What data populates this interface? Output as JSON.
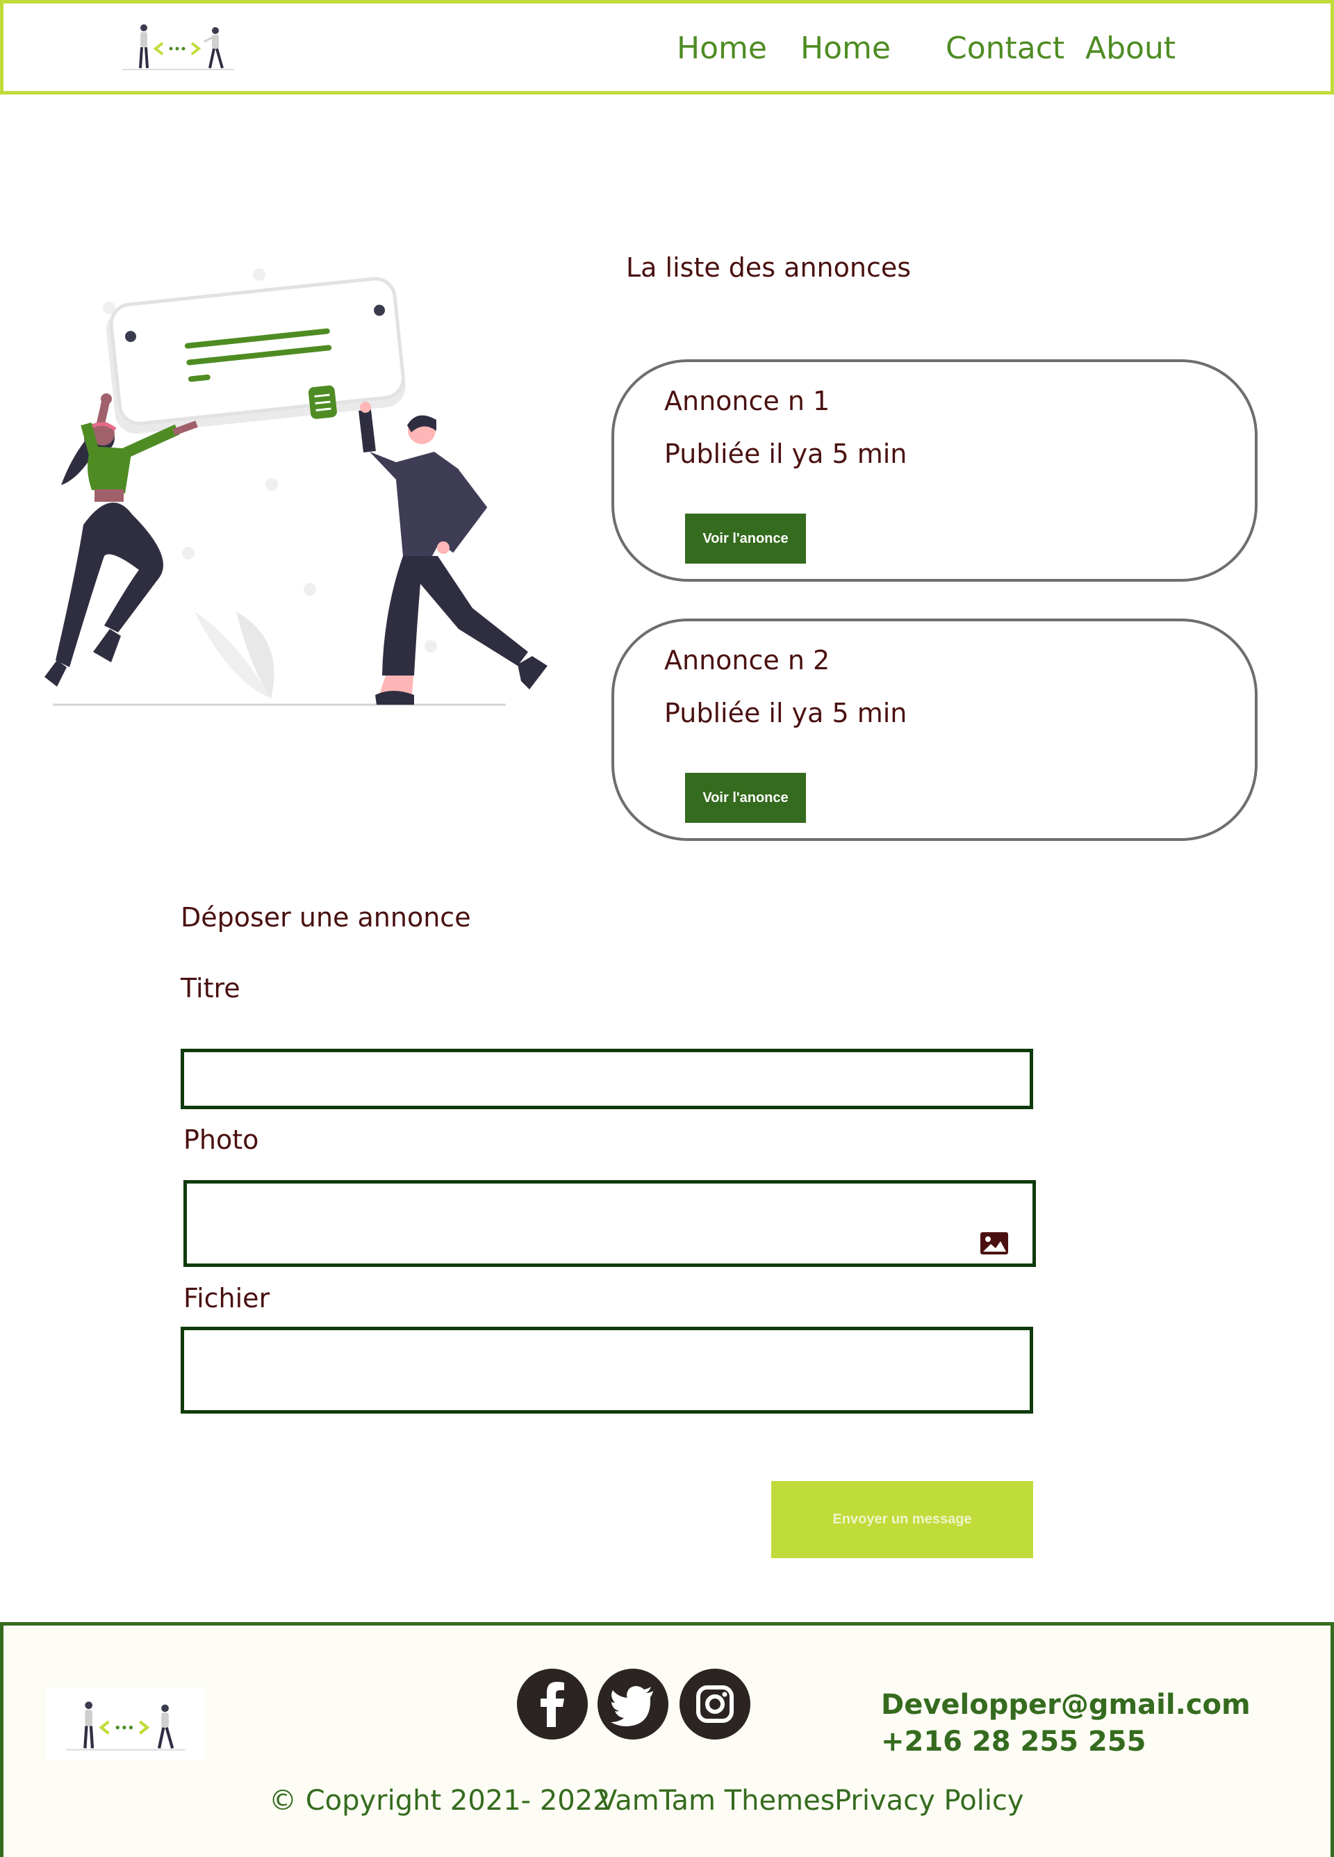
{
  "colors": {
    "accent_lime": "#c0dc3a",
    "brand_green": "#356b1e",
    "nav_green": "#4e8c23",
    "text_dark_red": "#4a1010",
    "field_border": "#0f3b0c",
    "social_dark": "#2b2422"
  },
  "header": {
    "logo_icon": "people-exchange-logo",
    "nav": [
      "Home",
      "Home",
      "Contact",
      "About"
    ]
  },
  "illustration": {
    "icon": "people-celebrating-illustration"
  },
  "listing": {
    "title": "La liste des annonces",
    "cards": [
      {
        "title": "Annonce n 1",
        "meta": "Publiée il ya 5 min",
        "button": "Voir l'anonce"
      },
      {
        "title": "Annonce n 2",
        "meta": "Publiée il ya 5 min",
        "button": "Voir l'anonce"
      }
    ]
  },
  "form": {
    "title": "Déposer une annonce",
    "titre_label": "Titre",
    "titre_value": "",
    "photo_label": "Photo",
    "photo_value": "",
    "photo_icon": "image-icon",
    "fichier_label": "Fichier",
    "fichier_value": "",
    "submit": "Envoyer un message"
  },
  "footer": {
    "logo_icon": "people-exchange-logo",
    "social": [
      "facebook-icon",
      "twitter-icon",
      "instagram-icon"
    ],
    "email": "Developper@gmail.com",
    "phone": "+216 28 255 255",
    "copyright": "© Copyright 2021- 2022",
    "themes": "VamTam Themes",
    "privacy": "Privacy Policy"
  }
}
